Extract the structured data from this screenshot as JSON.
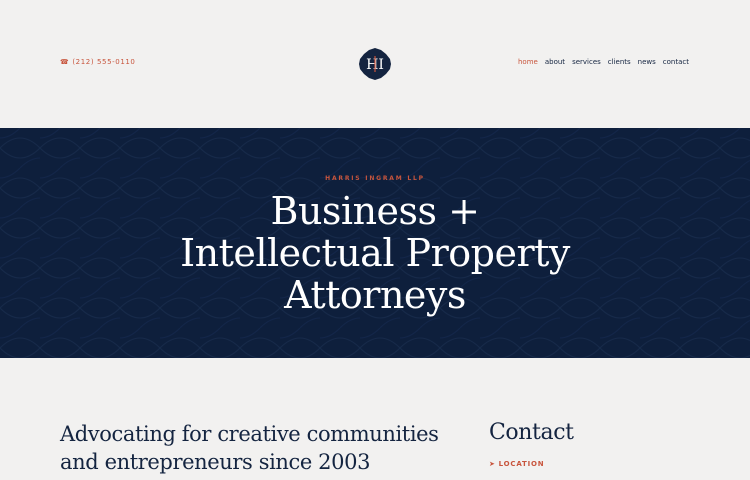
{
  "header": {
    "phone": "(212) 555-0110",
    "phone_icon": "phone-icon",
    "logo_letters": "HI",
    "nav": [
      {
        "label": "home",
        "active": true
      },
      {
        "label": "about",
        "active": false
      },
      {
        "label": "services",
        "active": false
      },
      {
        "label": "clients",
        "active": false
      },
      {
        "label": "news",
        "active": false
      },
      {
        "label": "contact",
        "active": false
      }
    ]
  },
  "hero": {
    "eyebrow": "HARRIS INGRAM LLP",
    "title_lines": [
      "Business +",
      "Intellectual Property",
      "Attorneys"
    ]
  },
  "main": {
    "tagline_lines": [
      "Advocating for creative communities",
      "and entrepreneurs since 2003"
    ],
    "contact_title": "Contact",
    "location_label": "LOCATION",
    "location_icon": "arrow-right-icon"
  },
  "colors": {
    "navy": "#0e1f3c",
    "accent": "#c8553d",
    "background": "#f2f1f0",
    "text": "#142440"
  }
}
